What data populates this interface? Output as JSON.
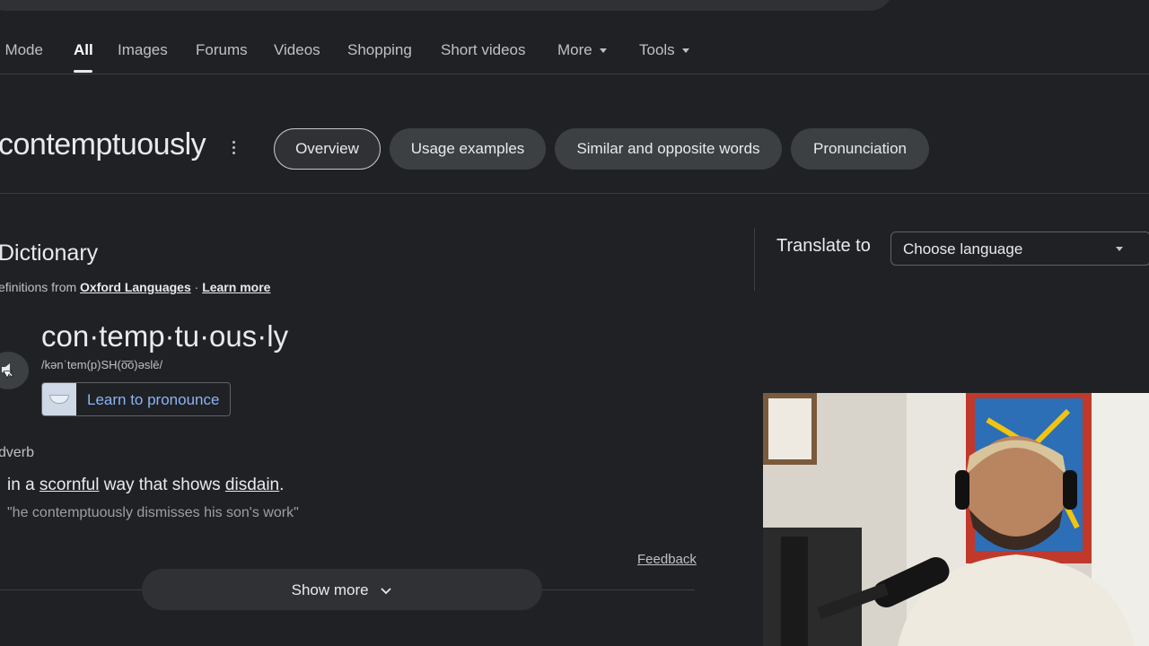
{
  "tabs": [
    {
      "label": "I Mode",
      "active": false
    },
    {
      "label": "All",
      "active": true
    },
    {
      "label": "Images",
      "active": false
    },
    {
      "label": "Forums",
      "active": false
    },
    {
      "label": "Videos",
      "active": false
    },
    {
      "label": "Shopping",
      "active": false
    },
    {
      "label": "Short videos",
      "active": false
    },
    {
      "label": "More",
      "active": false,
      "dropdown": true
    },
    {
      "label": "Tools",
      "active": false,
      "dropdown": true
    }
  ],
  "query": {
    "word": "contemptuously",
    "chips": [
      {
        "label": "Overview",
        "selected": true
      },
      {
        "label": "Usage examples",
        "selected": false
      },
      {
        "label": "Similar and opposite words",
        "selected": false
      },
      {
        "label": "Pronunciation",
        "selected": false
      }
    ]
  },
  "dictionary": {
    "heading": "Dictionary",
    "source_prefix": "efinitions from",
    "source_link": "Oxford Languages",
    "separator": "·",
    "learn_more": "Learn more",
    "syllables": "con·temp·tu·ous·ly",
    "phonetic": "/kənˈtem(p)SH(o͞o)əslē/",
    "learn_to_pronounce": "Learn to pronounce",
    "part_of_speech": "dverb",
    "definition": {
      "before": "in a ",
      "link1": "scornful",
      "middle": " way that shows ",
      "link2": "disdain",
      "after": "."
    },
    "example": "\"he contemptuously dismisses his son's work\"",
    "feedback": "Feedback",
    "show_more": "Show more"
  },
  "translate": {
    "label": "Translate to",
    "select_value": "Choose language"
  },
  "icons": {
    "speaker": "speaker-icon",
    "kebab": "more-vert-icon",
    "chevron": "chevron-down-icon"
  },
  "colors": {
    "background": "#202124",
    "link_blue": "#8ab4f8",
    "chip_bg": "#3c4043"
  }
}
